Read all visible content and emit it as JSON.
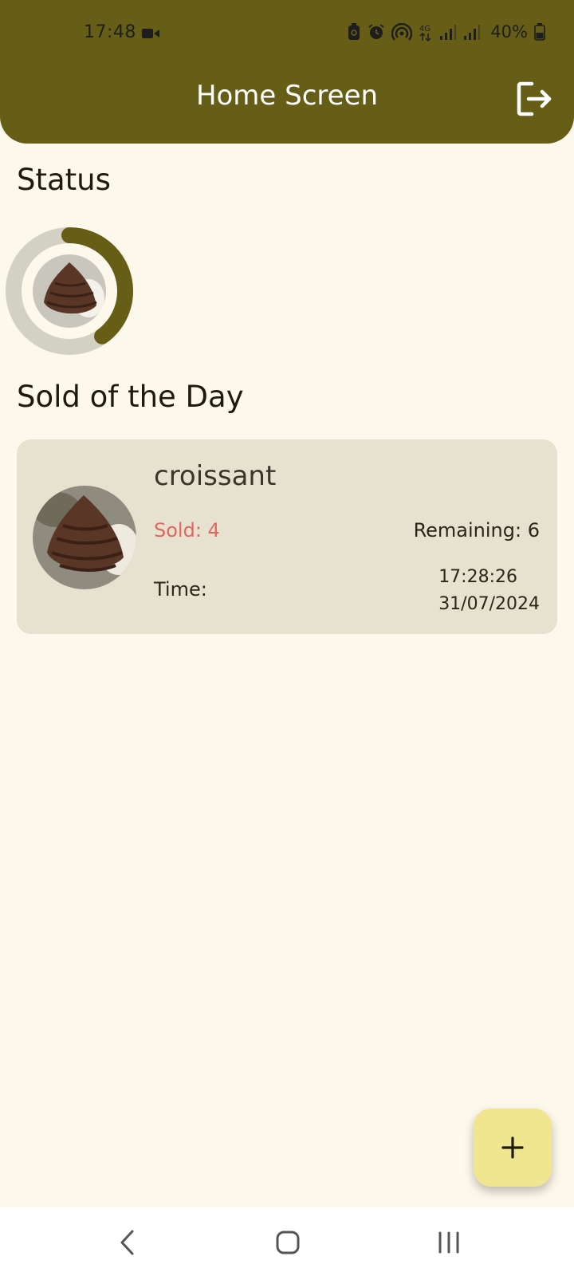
{
  "status_bar": {
    "time": "17:48",
    "battery": "40%",
    "icons": [
      "video-icon",
      "battery-saver-icon",
      "alarm-icon",
      "hotspot-icon",
      "4g-icon",
      "signal-icon",
      "signal-icon",
      "battery-icon"
    ]
  },
  "header": {
    "title": "Home Screen",
    "logout_icon": "logout-icon",
    "background_color": "#665e16"
  },
  "status_section": {
    "title": "Status",
    "progress_fraction": 0.4,
    "progress_color": "#665e16",
    "track_color": "#d3d0c4"
  },
  "sold_section": {
    "title": "Sold of the Day",
    "items": [
      {
        "name": "croissant",
        "sold": "Sold: 4",
        "remaining": "Remaining: 6",
        "time_label": "Time:",
        "time": "17:28:26",
        "date": "31/07/2024"
      }
    ]
  },
  "fab": {
    "icon": "plus-icon",
    "color": "#f0e68f"
  },
  "nav": {
    "back_icon": "back-icon",
    "home_icon": "home-icon",
    "recents_icon": "recents-icon"
  }
}
